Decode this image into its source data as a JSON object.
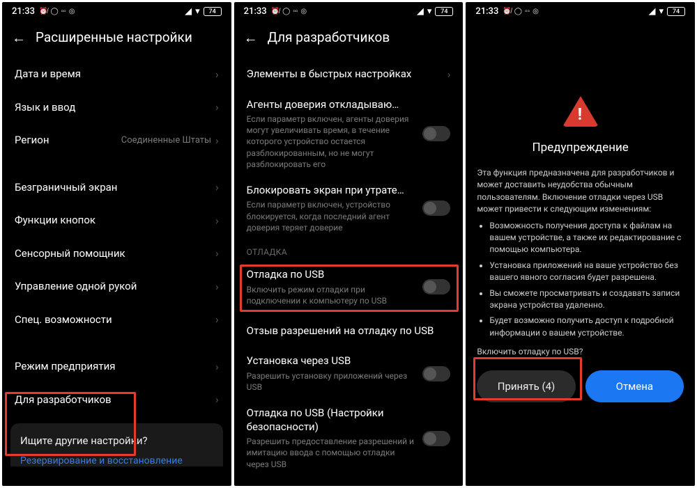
{
  "status": {
    "time": "21:33",
    "battery": "74"
  },
  "screen1": {
    "title": "Расширенные настройки",
    "items": {
      "datetime": "Дата и время",
      "lang": "Язык и ввод",
      "region_label": "Регион",
      "region_value": "Соединенные Штаты",
      "edgeless": "Безграничный экран",
      "buttons": "Функции кнопок",
      "touch_assist": "Сенсорный помощник",
      "one_hand": "Управление одной рукой",
      "accessibility": "Спец. возможности",
      "enterprise": "Режим предприятия",
      "dev": "Для разработчиков"
    },
    "footer": {
      "title": "Ищите другие настройки?",
      "link": "Резервирование и восстановление"
    }
  },
  "screen2": {
    "title": "Для разработчиков",
    "qs": "Элементы в быстрых настройках",
    "trust": {
      "title": "Агенты доверия откладываю…",
      "sub": "Если параметр включен, агенты доверия могут увеличивать время, в течение которого устройство остается разблокированным, но не могут разблокировать его"
    },
    "lock": {
      "title": "Блокировать экран при утрате…",
      "sub": "Если параметр включен, устройство блокируется, когда последний агент доверия теряет доверие"
    },
    "section_debug": "ОТЛАДКА",
    "usb_debug": {
      "title": "Отладка по USB",
      "sub": "Включить режим отладки при подключении к компьютеру по USB"
    },
    "revoke": "Отзыв разрешений на отладку по USB",
    "install_usb": {
      "title": "Установка через USB",
      "sub": "Разрешить установку приложений через USB"
    },
    "usb_sec": {
      "title": "Отладка по USB (Настройки безопасности)",
      "sub": "Разрешить предоставление разрешений и имитацию ввода с помощью отладки через USB"
    }
  },
  "screen3": {
    "title": "Предупреждение",
    "intro": "Эта функция предназначена для разработчиков и может доставить неудобства обычным пользователям. Включение отладки через USB может привести к следующим изменениям:",
    "bullets": [
      "Возможность получения доступа к файлам на вашем устройстве, а также их редактирование с помощью компьютера.",
      "Установка приложений на ваше устройство без вашего явного согласия будет разрешена.",
      "Вы сможете просматривать и создавать записи экрана устройства удаленно.",
      "Будет возможно получить доступ к подробной информации о вашем устройстве."
    ],
    "confirm": "Включить отладку по USB?",
    "accept": "Принять (4)",
    "cancel": "Отмена"
  }
}
